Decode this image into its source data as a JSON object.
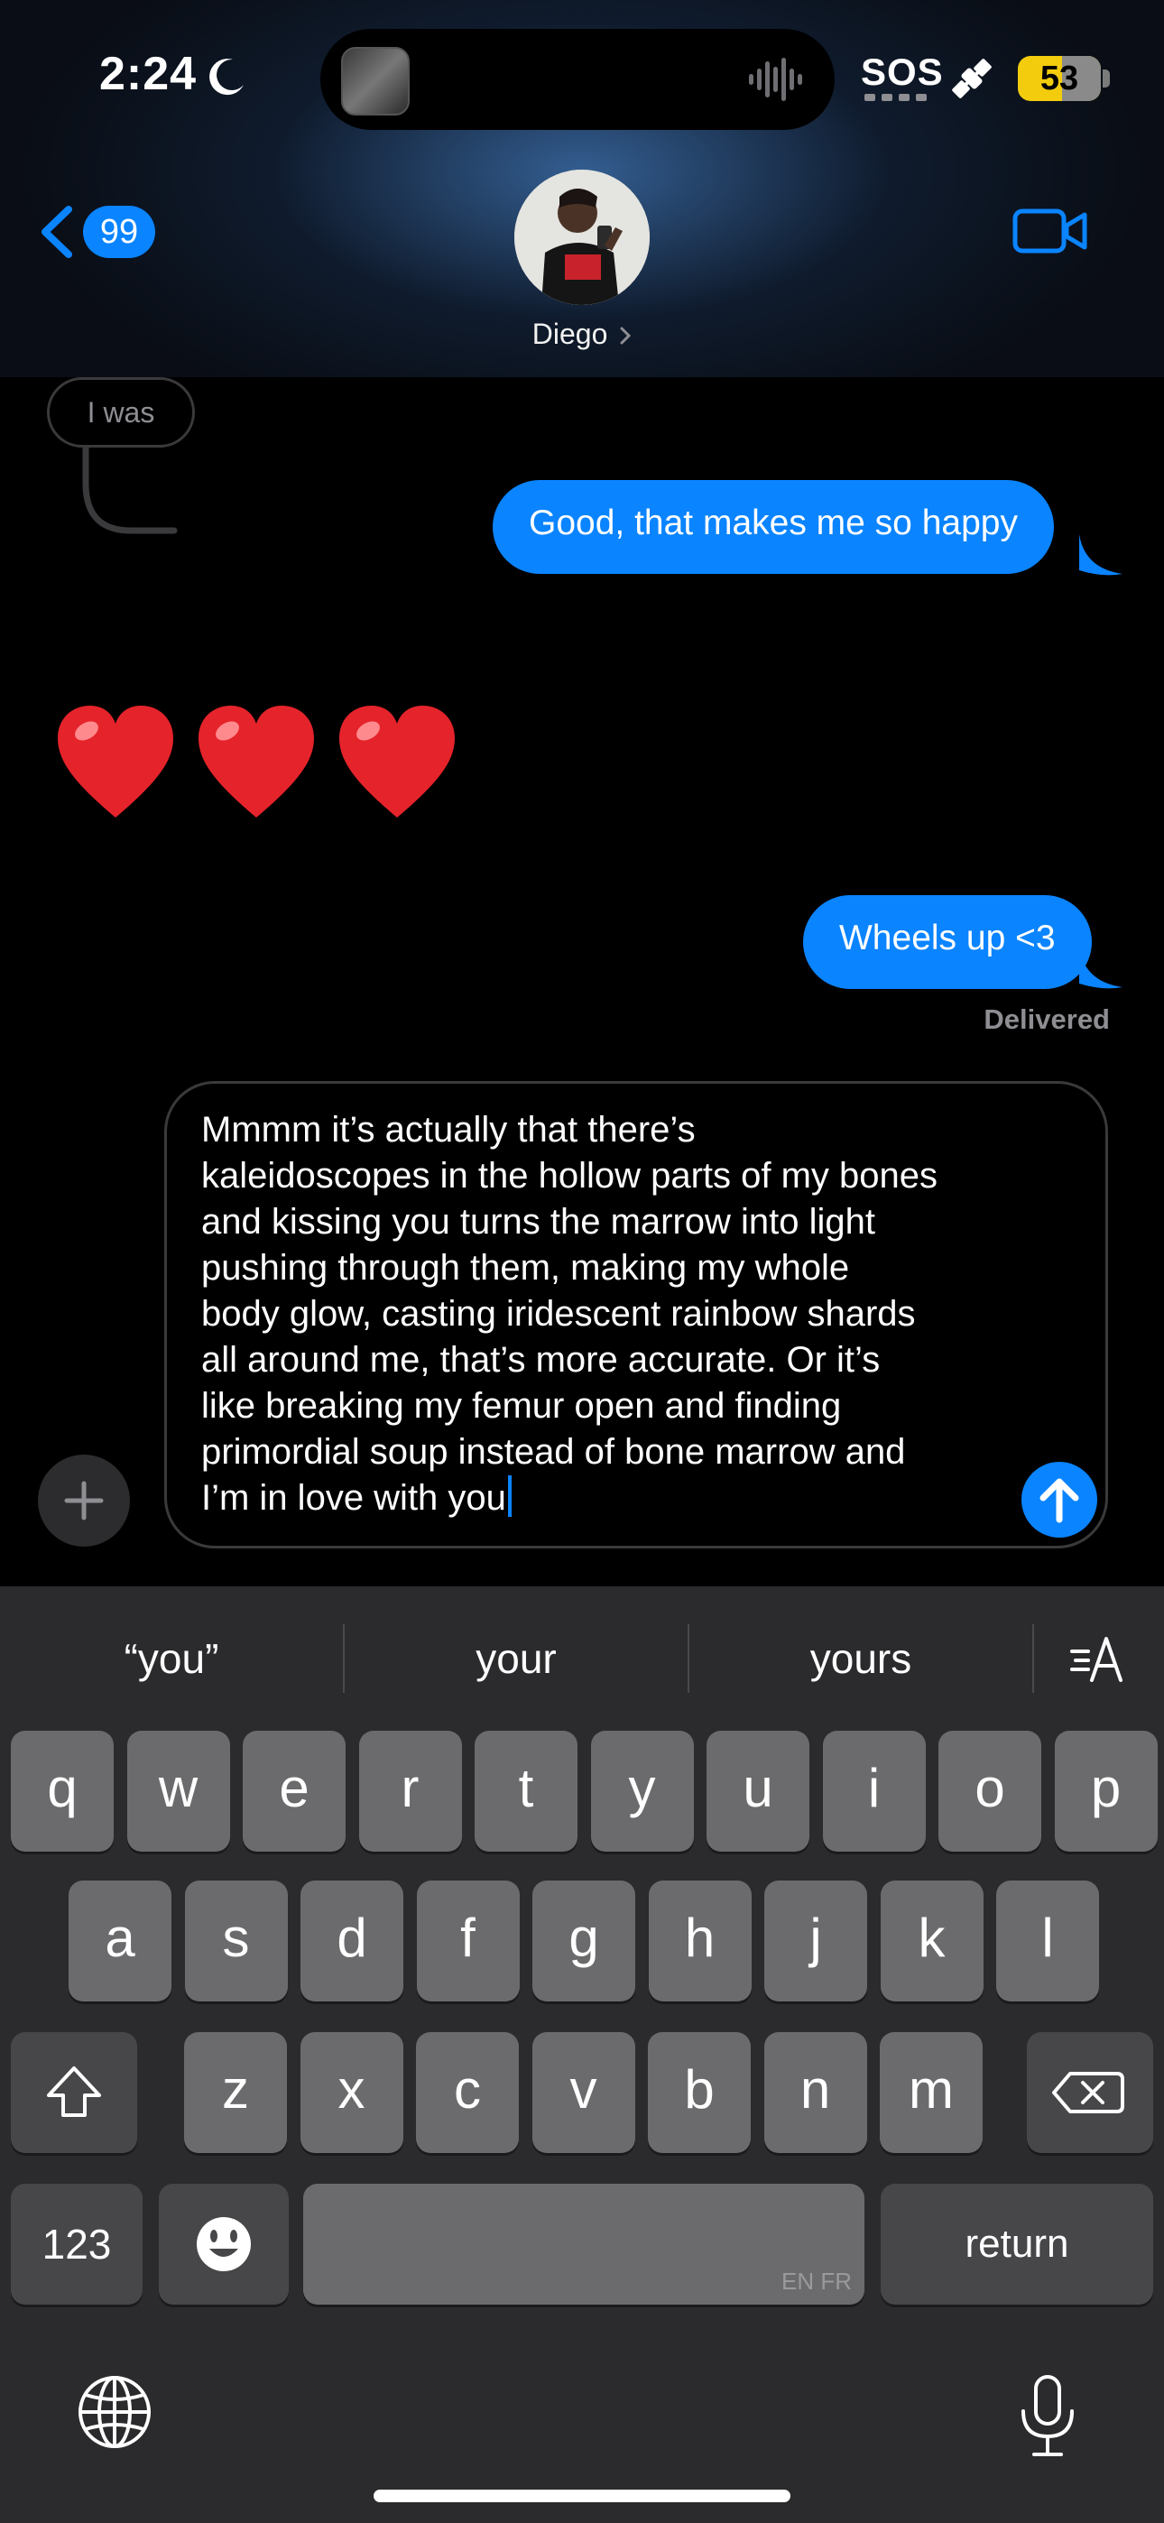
{
  "status_bar": {
    "time": "2:24",
    "sos": "SOS",
    "battery": "53",
    "battery_level": 0.53
  },
  "header": {
    "back_badge": "99",
    "contact_name": "Diego",
    "icons": [
      "chevron-left-icon",
      "video-camera-icon",
      "chevron-right-icon"
    ]
  },
  "messages": {
    "reply_preview": "I was",
    "sent_1": "Good, that makes me so happy",
    "hearts": "❤️❤️❤️",
    "sent_2": "Wheels up <3",
    "status": "Delivered"
  },
  "composer": {
    "text": "Mmmm it’s actually that there’s\nkaleidoscopes in the hollow parts of my bones\nand kissing you turns the marrow into light\npushing through them, making my whole\nbody glow, casting iridescent rainbow shards\nall around me, that’s more accurate. Or it’s\nlike breaking my femur open and finding\nprimordial soup instead of bone marrow and\nI’m in love with you"
  },
  "keyboard": {
    "suggestions": [
      "“you”",
      "your",
      "yours"
    ],
    "row1": [
      "q",
      "w",
      "e",
      "r",
      "t",
      "y",
      "u",
      "i",
      "o",
      "p"
    ],
    "row2": [
      "a",
      "s",
      "d",
      "f",
      "g",
      "h",
      "j",
      "k",
      "l"
    ],
    "row3": [
      "z",
      "x",
      "c",
      "v",
      "b",
      "n",
      "m"
    ],
    "numbers_label": "123",
    "space_lang": "EN FR",
    "return_label": "return"
  },
  "colors": {
    "imessage_blue": "#0b84ff",
    "background": "#000000",
    "keyboard": "#2b2b2d",
    "battery": "#f3cc0e"
  }
}
